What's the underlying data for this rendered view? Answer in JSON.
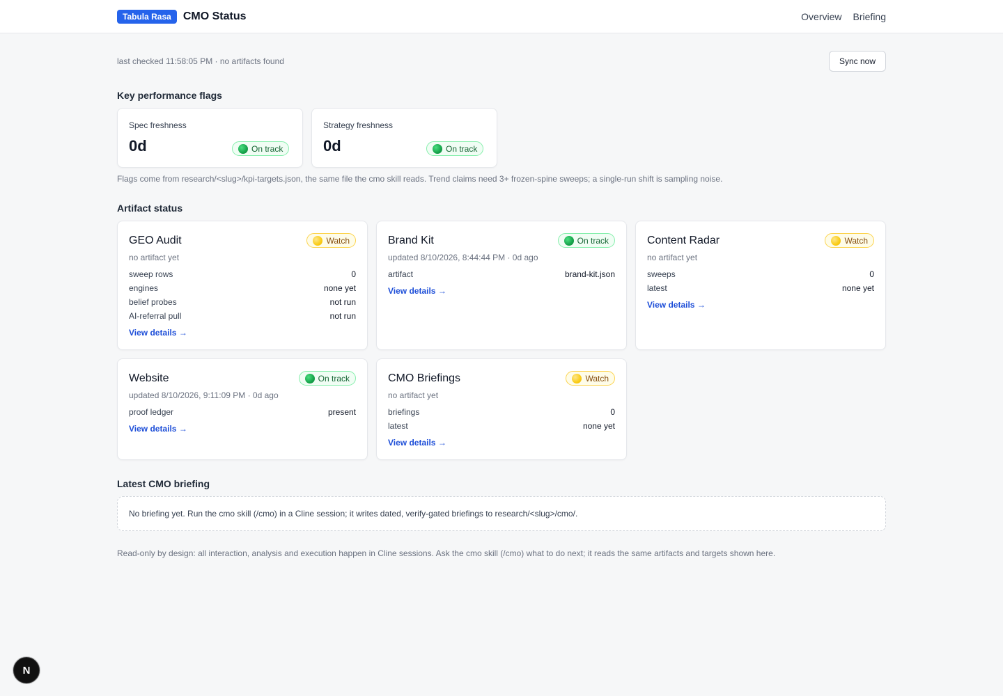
{
  "header": {
    "badge": "Tabula Rasa",
    "title": "CMO Status",
    "nav": [
      "Overview",
      "Briefing"
    ]
  },
  "status": {
    "line": "last checked 11:58:05 PM · no artifacts found",
    "sync_label": "Sync now"
  },
  "kpi": {
    "section_title": "Key performance flags",
    "cards": [
      {
        "label": "Spec freshness",
        "value": "0d",
        "status": "On track"
      },
      {
        "label": "Strategy freshness",
        "value": "0d",
        "status": "On track"
      }
    ],
    "note": "Flags come from research/<slug>/kpi-targets.json, the same file the cmo skill reads. Trend claims need 3+ frozen-spine sweeps; a single-run shift is sampling noise."
  },
  "artifacts": {
    "section_title": "Artifact status",
    "link_label": "View details →",
    "cards": [
      {
        "title": "GEO Audit",
        "status": "Watch",
        "sub": "no artifact yet",
        "rows": [
          {
            "k": "sweep rows",
            "v": "0"
          },
          {
            "k": "engines",
            "v": "none yet"
          },
          {
            "k": "belief probes",
            "v": "not run"
          },
          {
            "k": "AI-referral pull",
            "v": "not run"
          }
        ]
      },
      {
        "title": "Brand Kit",
        "status": "On track",
        "sub": "updated 8/10/2026, 8:44:44 PM · 0d ago",
        "rows": [
          {
            "k": "artifact",
            "v": "brand-kit.json"
          }
        ]
      },
      {
        "title": "Content Radar",
        "status": "Watch",
        "sub": "no artifact yet",
        "rows": [
          {
            "k": "sweeps",
            "v": "0"
          },
          {
            "k": "latest",
            "v": "none yet"
          }
        ]
      },
      {
        "title": "Website",
        "status": "On track",
        "sub": "updated 8/10/2026, 9:11:09 PM · 0d ago",
        "rows": [
          {
            "k": "proof ledger",
            "v": "present"
          }
        ]
      },
      {
        "title": "CMO Briefings",
        "status": "Watch",
        "sub": "no artifact yet",
        "rows": [
          {
            "k": "briefings",
            "v": "0"
          },
          {
            "k": "latest",
            "v": "none yet"
          }
        ]
      }
    ]
  },
  "briefing": {
    "section_title": "Latest CMO briefing",
    "empty_text": "No briefing yet. Run the cmo skill (/cmo) in a Cline session; it writes dated, verify-gated briefings to research/<slug>/cmo/."
  },
  "footer_note": "Read-only by design: all interaction, analysis and execution happen in Cline sessions. Ask the cmo skill (/cmo) what to do next; it reads the same artifacts and targets shown here.",
  "dev_button": {
    "glyph": "N"
  }
}
